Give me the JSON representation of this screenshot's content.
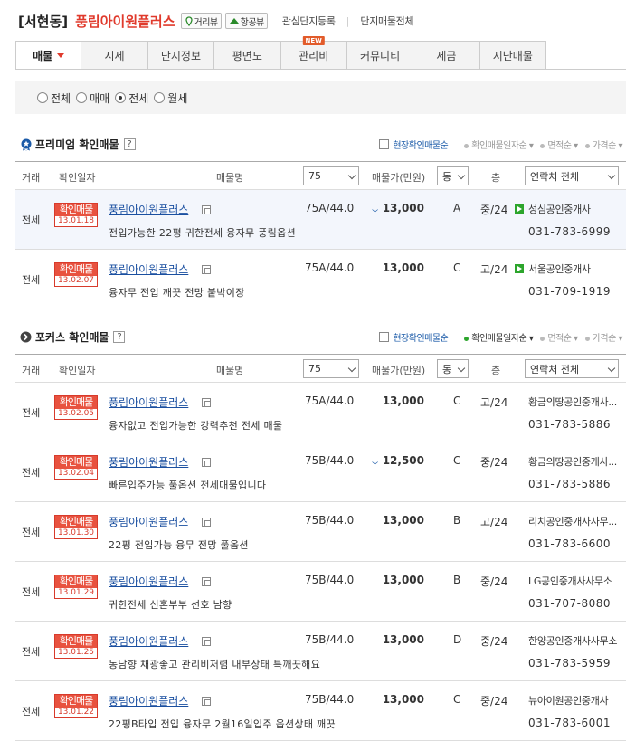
{
  "header": {
    "region": "[서현동]",
    "complex_name": "풍림아이원플러스",
    "street_view_label": "거리뷰",
    "aerial_view_label": "항공뷰",
    "watch_label": "관심단지등록",
    "all_listings_label": "단지매물전체"
  },
  "tabs": [
    {
      "label": "매물"
    },
    {
      "label": "시세"
    },
    {
      "label": "단지정보"
    },
    {
      "label": "평면도"
    },
    {
      "label": "관리비",
      "badge": "NEW"
    },
    {
      "label": "커뮤니티"
    },
    {
      "label": "세금"
    },
    {
      "label": "지난매물"
    }
  ],
  "filter": {
    "options": [
      "전체",
      "매매",
      "전세",
      "월세"
    ],
    "selected": "전세"
  },
  "columns": {
    "type": "거래",
    "date": "확인일자",
    "name": "매물명",
    "area_select": "75",
    "price": "매물가(만원)",
    "dong_select": "동",
    "floor": "층",
    "agent_select": "연락처 전체"
  },
  "stamp_label": "확인매물",
  "premium": {
    "title": "프리미엄 확인매물",
    "help": "?",
    "checkbox_label": "현장확인매물순",
    "sorts": [
      "확인매물일자순",
      "면적순",
      "가격순"
    ],
    "listings": [
      {
        "type": "전세",
        "date": "13.01.18",
        "name": "풍림아이원플러스",
        "desc": "전입가능한 22평 귀한전세 융자무 풍림옵션",
        "area": "75A/44.0",
        "price": "13,000",
        "price_drop": true,
        "dong": "A",
        "floor": "중/24",
        "agent": "성심공인중개사",
        "agent_pin": true,
        "phone": "031-783-6999"
      },
      {
        "type": "전세",
        "date": "13.02.07",
        "name": "풍림아이원플러스",
        "desc": "융자무 전입 깨끗 전망 붙박이장",
        "area": "75A/44.0",
        "price": "13,000",
        "price_drop": false,
        "dong": "C",
        "floor": "고/24",
        "agent": "서울공인중개사",
        "agent_pin": true,
        "phone": "031-709-1919"
      }
    ]
  },
  "focus": {
    "title": "포커스 확인매물",
    "help": "?",
    "checkbox_label": "현장확인매물순",
    "sorts": [
      "확인매물일자순",
      "면적순",
      "가격순"
    ],
    "listings": [
      {
        "type": "전세",
        "date": "13.02.05",
        "name": "풍림아이원플러스",
        "desc": "융자없고 전입가능한 강력추천 전세 매물",
        "area": "75A/44.0",
        "price": "13,000",
        "price_drop": false,
        "dong": "C",
        "floor": "고/24",
        "agent": "황금의땅공인중개사...",
        "agent_pin": false,
        "phone": "031-783-5886"
      },
      {
        "type": "전세",
        "date": "13.02.04",
        "name": "풍림아이원플러스",
        "desc": "빠른입주가능 풀옵션 전세매물입니다",
        "area": "75B/44.0",
        "price": "12,500",
        "price_drop": true,
        "dong": "C",
        "floor": "중/24",
        "agent": "황금의땅공인중개사...",
        "agent_pin": false,
        "phone": "031-783-5886"
      },
      {
        "type": "전세",
        "date": "13.01.30",
        "name": "풍림아이원플러스",
        "desc": "22평 전입가능 융무 전망 풀옵션",
        "area": "75B/44.0",
        "price": "13,000",
        "price_drop": false,
        "dong": "B",
        "floor": "고/24",
        "agent": "리치공인중개사사무...",
        "agent_pin": false,
        "phone": "031-783-6600"
      },
      {
        "type": "전세",
        "date": "13.01.29",
        "name": "풍림아이원플러스",
        "desc": "귀한전세 신혼부부 선호 남향",
        "area": "75B/44.0",
        "price": "13,000",
        "price_drop": false,
        "dong": "B",
        "floor": "중/24",
        "agent": "LG공인중개사사무소",
        "agent_pin": false,
        "phone": "031-707-8080"
      },
      {
        "type": "전세",
        "date": "13.01.25",
        "name": "풍림아이원플러스",
        "desc": "동남향 채광좋고 관리비저렴 내부상태 특깨끗해요",
        "area": "75B/44.0",
        "price": "13,000",
        "price_drop": false,
        "dong": "D",
        "floor": "중/24",
        "agent": "한양공인중개사사무소",
        "agent_pin": false,
        "phone": "031-783-5959"
      },
      {
        "type": "전세",
        "date": "13.01.22",
        "name": "풍림아이원플러스",
        "desc": "22평B타입 전입 융자무 2월16일입주 옵션상태 깨끗",
        "area": "75B/44.0",
        "price": "13,000",
        "price_drop": false,
        "dong": "C",
        "floor": "중/24",
        "agent": "뉴아이원공인중개사",
        "agent_pin": false,
        "phone": "031-783-6001"
      }
    ]
  }
}
